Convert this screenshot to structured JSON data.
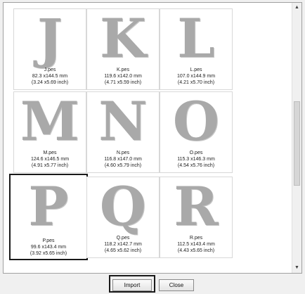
{
  "files": [
    {
      "letter": "J",
      "name": "J.pes",
      "size_mm": "82.3 x144.5 mm",
      "size_inch": "(3.24 x5.69 inch)"
    },
    {
      "letter": "K",
      "name": "K.pes",
      "size_mm": "119.6 x142.0 mm",
      "size_inch": "(4.71 x5.59 inch)"
    },
    {
      "letter": "L",
      "name": "L.pes",
      "size_mm": "107.0 x144.9 mm",
      "size_inch": "(4.21 x5.70 inch)"
    },
    {
      "letter": "M",
      "name": "M.pes",
      "size_mm": "124.6 x146.5 mm",
      "size_inch": "(4.91 x5.77 inch)"
    },
    {
      "letter": "N",
      "name": "N.pes",
      "size_mm": "116.8 x147.0 mm",
      "size_inch": "(4.60 x5.79 inch)"
    },
    {
      "letter": "O",
      "name": "O.pes",
      "size_mm": "115.3 x146.3 mm",
      "size_inch": "(4.54 x5.76 inch)"
    },
    {
      "letter": "P",
      "name": "P.pes",
      "size_mm": "99.6 x143.4 mm",
      "size_inch": "(3.92 x5.65 inch)",
      "selected": true
    },
    {
      "letter": "Q",
      "name": "Q.pes",
      "size_mm": "118.2 x142.7 mm",
      "size_inch": "(4.65 x5.62 inch)"
    },
    {
      "letter": "R",
      "name": "R.pes",
      "size_mm": "112.5 x143.4 mm",
      "size_inch": "(4.43 x5.65 inch)"
    }
  ],
  "buttons": {
    "import": "Import",
    "close": "Close"
  },
  "scrollbar": {
    "up_icon": "triangle-up",
    "down_icon": "triangle-down"
  },
  "colors": {
    "glyph": "#a9a9a9",
    "selection_border": "#1a1a1a"
  }
}
